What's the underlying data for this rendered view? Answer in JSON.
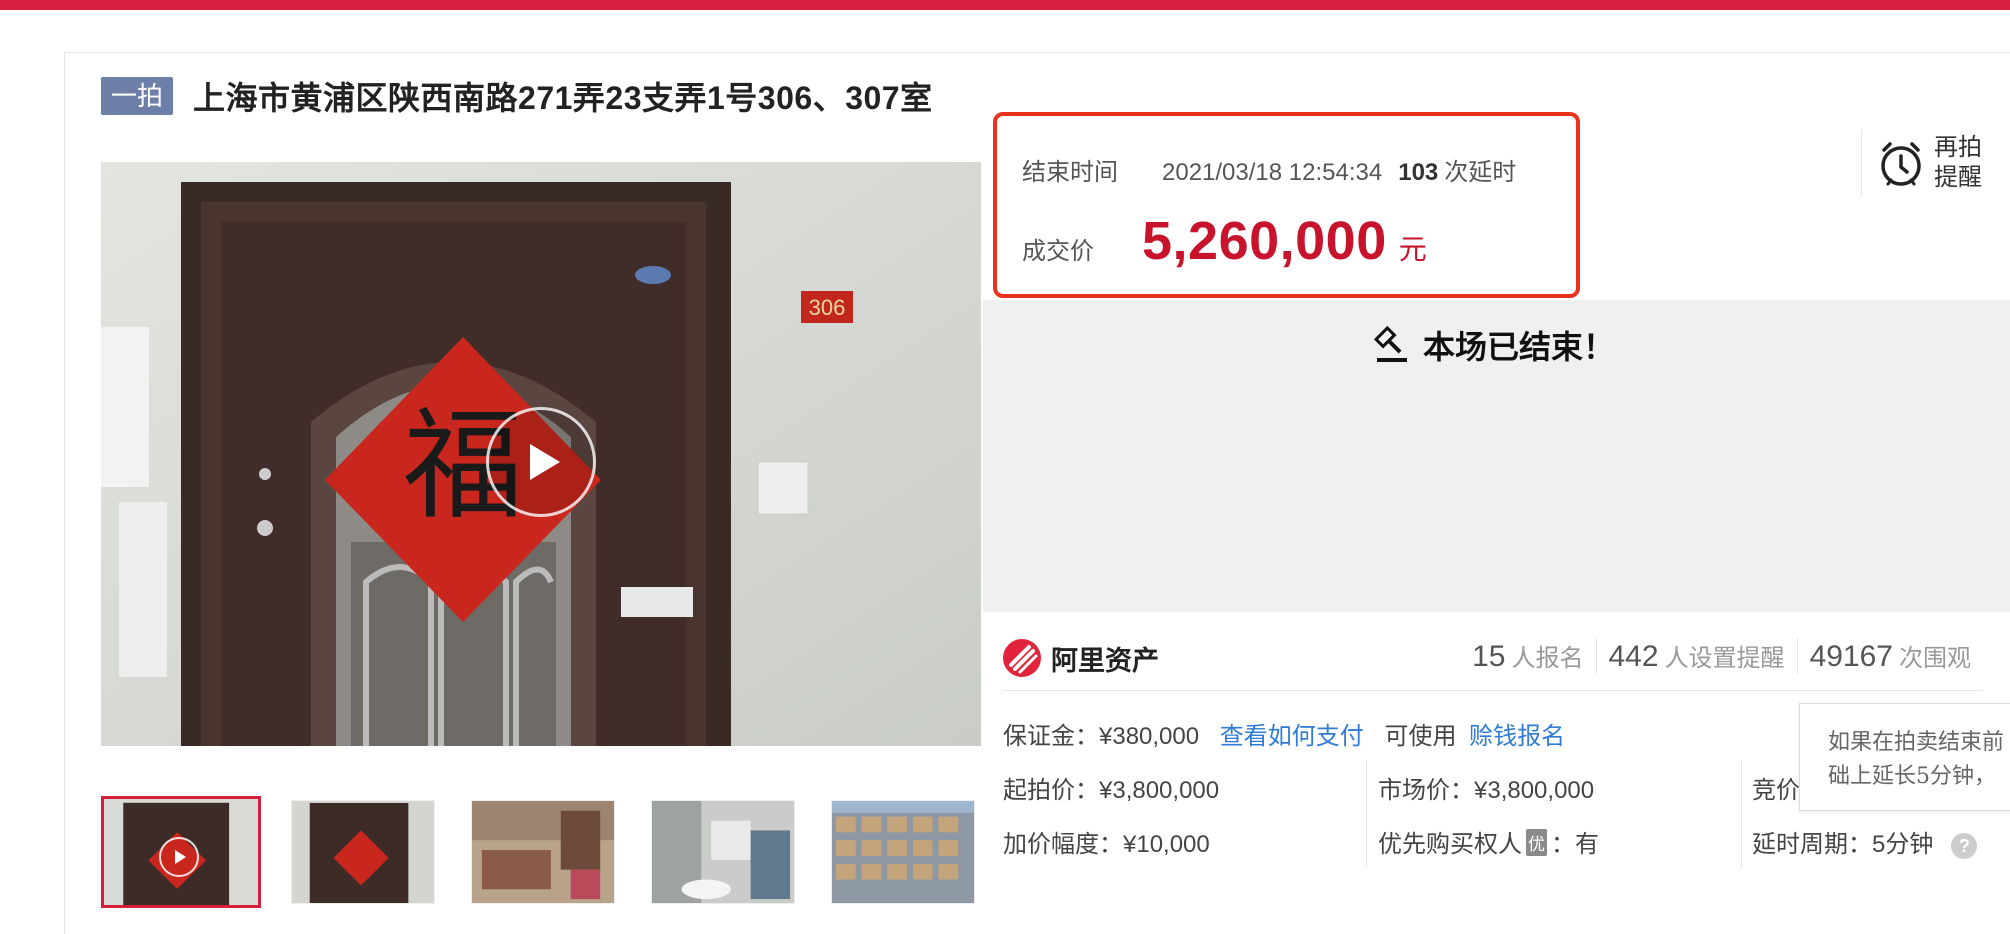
{
  "title": {
    "round_badge": "一拍",
    "text": "上海市黄浦区陕西南路271弄23支弄1号306、307室"
  },
  "price_box": {
    "end_time_label": "结束时间",
    "end_time": "2021/03/18 12:54:34",
    "extensions_count": "103",
    "extensions_label": "次延时",
    "deal_price_label": "成交价",
    "deal_price": "5,260,000",
    "unit": "元"
  },
  "reminder": {
    "label": "再拍提醒",
    "icon": "alarm-clock-icon"
  },
  "status": {
    "message": "本场已结束！",
    "icon": "auction-hammer-icon"
  },
  "platform": {
    "name": "阿里资产",
    "brand_color": "#e1243b"
  },
  "stats": [
    {
      "value": "15",
      "label": "人报名"
    },
    {
      "value": "442",
      "label": "人设置提醒"
    },
    {
      "value": "49167",
      "label": "次围观"
    }
  ],
  "deposit": {
    "label": "保证金：¥380,000",
    "pay_link": "查看如何支付",
    "available_label": "可使用",
    "finance_link": "赊钱报名"
  },
  "details": {
    "start_price": "起拍价：¥3,800,000",
    "market_price": "市场价：¥3,800,000",
    "bid_cycle": "竞价",
    "increment": "加价幅度：¥10,000",
    "priority_label": "优先购买权人",
    "priority_badge": "优",
    "priority_value": "：有",
    "delay_cycle": "延时周期：5分钟",
    "help_icon": "?"
  },
  "tooltip": {
    "line1": "如果在拍卖结束前",
    "line2": "础上延长5分钟，"
  },
  "colors": {
    "accent_red": "#d61f3e",
    "price_red": "#c8132d",
    "highlight_border": "#e8321b",
    "link_blue": "#2f7bd6",
    "badge_blue": "#6d7ea8"
  }
}
